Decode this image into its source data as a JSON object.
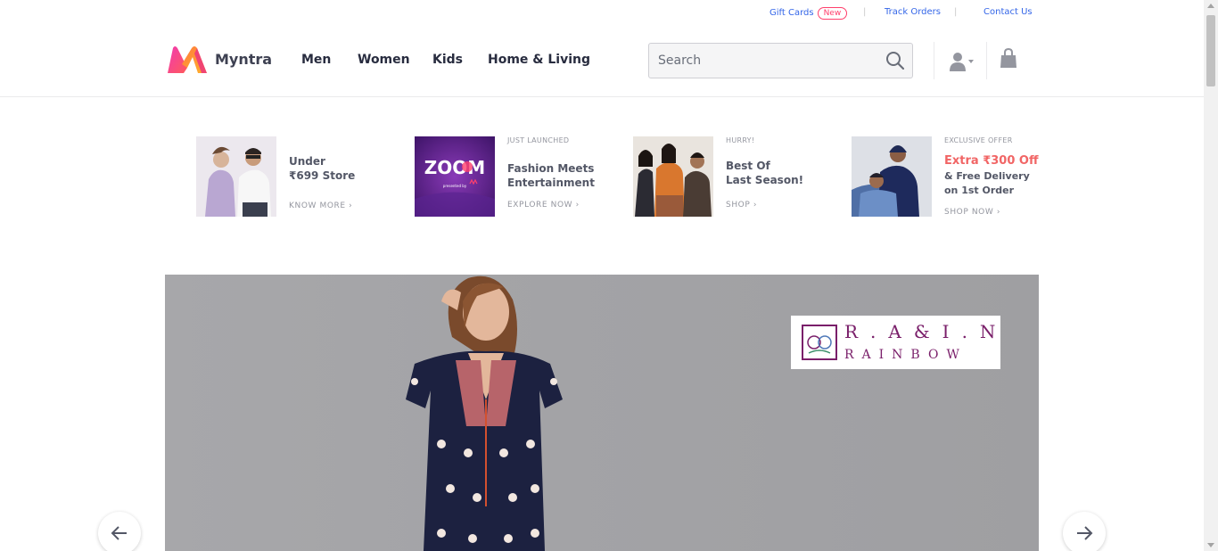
{
  "utility_bar": {
    "gift_cards": "Gift Cards",
    "new_badge": "New",
    "track_orders": "Track Orders",
    "contact_us": "Contact Us"
  },
  "header": {
    "brand": "Myntra",
    "nav": [
      "Men",
      "Women",
      "Kids",
      "Home & Living"
    ],
    "search": {
      "placeholder": "Search",
      "value": ""
    }
  },
  "promos": [
    {
      "eyebrow": "",
      "title_lines": [
        "Under",
        "₹699 Store"
      ],
      "cta": "KNOW MORE ›"
    },
    {
      "eyebrow": "JUST LAUNCHED",
      "title_lines": [
        "Fashion Meets",
        "Entertainment"
      ],
      "cta": "EXPLORE NOW ›",
      "image_text": "ZOOM"
    },
    {
      "eyebrow": "HURRY!",
      "title_lines": [
        "Best Of",
        "Last Season!"
      ],
      "cta": "SHOP ›"
    },
    {
      "eyebrow": "EXCLUSIVE OFFER",
      "offer": "Extra ₹300 Off",
      "title_lines": [
        "& Free Delivery",
        "on 1st Order"
      ],
      "cta": "SHOP NOW ›"
    }
  ],
  "hero": {
    "brand_line1": "R.A&I.N",
    "brand_line2": "RAINBOW"
  },
  "icons": {
    "search": "search-icon",
    "profile": "profile-icon",
    "bag": "bag-icon",
    "prev": "arrow-left-icon",
    "next": "arrow-right-icon"
  },
  "colors": {
    "brand_pink": "#ff3f6c",
    "link_blue": "#3466e8",
    "offer_red": "#f16565",
    "hero_bg": "#a5a5a8",
    "brand_purple": "#7a1f6a"
  }
}
